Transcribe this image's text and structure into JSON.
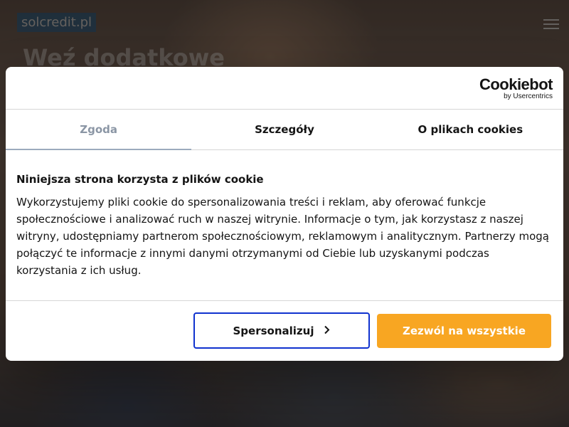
{
  "site": {
    "logo_text": "solcredit.pl",
    "hero_title": "Weź dodatkowe"
  },
  "cookie_dialog": {
    "brand": {
      "name": "Cookiebot",
      "sub": "by Usercentrics"
    },
    "tabs": [
      {
        "label": "Zgoda",
        "active": true
      },
      {
        "label": "Szczegóły",
        "active": false
      },
      {
        "label": "O plikach cookies",
        "active": false
      }
    ],
    "title": "Niniejsza strona korzysta z plików cookie",
    "text": "Wykorzystujemy pliki cookie do spersonalizowania treści i reklam, aby oferować funkcje społecznościowe i analizować ruch w naszej witrynie. Informacje o tym, jak korzystasz z naszej witryny, udostępniamy partnerom społecznościowym, reklamowym i analitycznym. Partnerzy mogą połączyć te informacje z innymi danymi otrzymanymi od Ciebie lub uzyskanymi podczas korzystania z ich usług.",
    "buttons": {
      "customize": "Spersonalizuj",
      "allow_all": "Zezwól na wszystkie"
    }
  },
  "colors": {
    "accent_button": "#f8a622",
    "outline_button": "#1032cf",
    "active_tab": "#8b96a5"
  },
  "icons": {
    "customize_chevron": "chevron-right-icon",
    "menu": "hamburger-menu-icon"
  }
}
